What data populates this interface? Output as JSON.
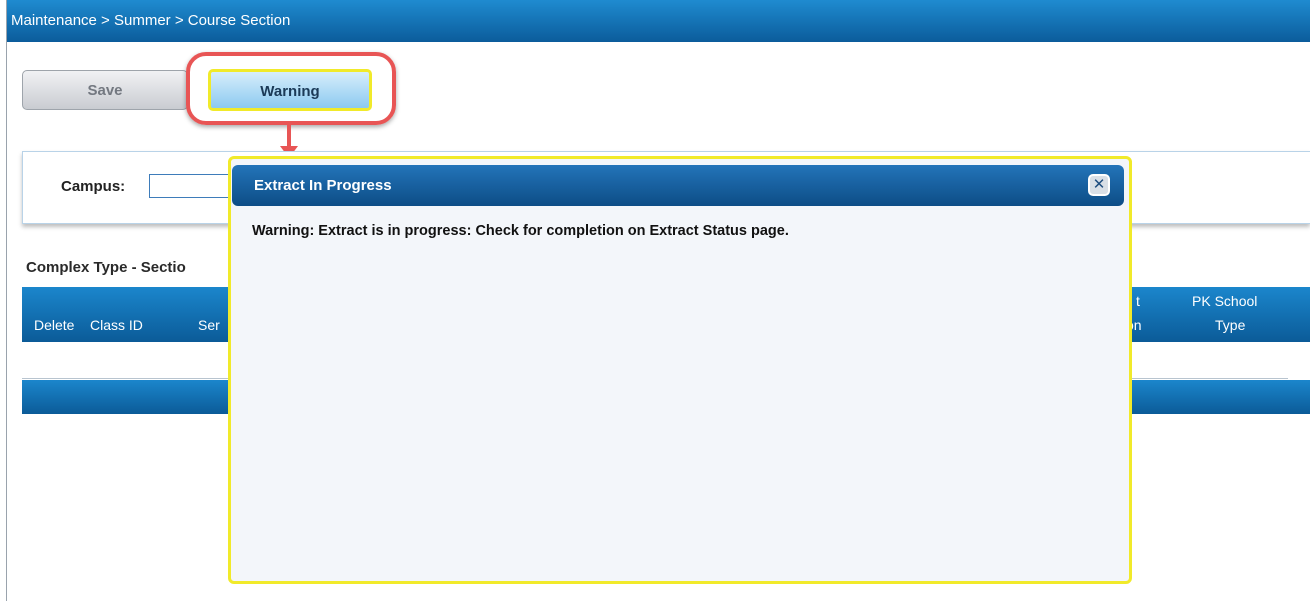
{
  "breadcrumb": "Maintenance > Summer > Course Section",
  "toolbar": {
    "save_label": "Save",
    "warning_label": "Warning"
  },
  "filter": {
    "campus_label": "Campus:",
    "campus_value": ""
  },
  "grid": {
    "title": "Complex Type - Sectio",
    "headers": {
      "delete": "Delete",
      "class_id": "Class ID",
      "ser": "Ser",
      "partial_1a": "t",
      "partial_1b": "on",
      "pk_school_type_line1": "PK School",
      "pk_school_type_line2": "Type"
    }
  },
  "dialog": {
    "title": "Extract In Progress",
    "message": "Warning: Extract is in progress: Check for completion on Extract Status page.",
    "close_icon": "close-icon"
  },
  "colors": {
    "header_blue": "#0b5c9b",
    "highlight_yellow": "#f1ea2a",
    "callout_red": "#e85555"
  }
}
